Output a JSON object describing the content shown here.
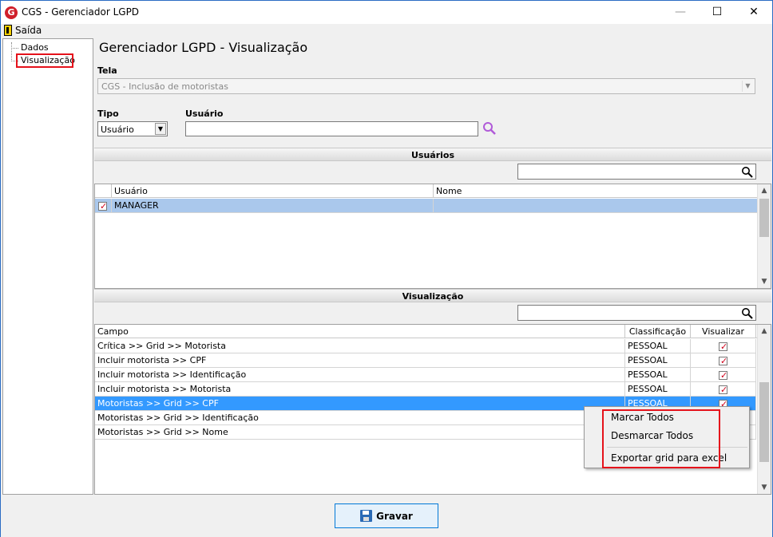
{
  "window": {
    "title": "CGS - Gerenciador LGPD",
    "app_icon_letter": "G"
  },
  "menu": {
    "exit_label": "Saída"
  },
  "tree": {
    "items": [
      "Dados",
      "Visualização"
    ]
  },
  "page": {
    "title": "Gerenciador LGPD - Visualização",
    "tela_label": "Tela",
    "tela_value": "CGS - Inclusão de motoristas",
    "tipo_label": "Tipo",
    "tipo_value": "Usuário",
    "usuario_label": "Usuário",
    "usuario_value": ""
  },
  "users_section": {
    "title": "Usuários",
    "columns": [
      "Usuário",
      "Nome"
    ],
    "rows": [
      {
        "checked": true,
        "usuario": "MANAGER",
        "nome": ""
      }
    ]
  },
  "view_section": {
    "title": "Visualização",
    "columns": [
      "Campo",
      "Classificação",
      "Visualizar"
    ],
    "rows": [
      {
        "campo": "Crítica >> Grid >> Motorista",
        "classificacao": "PESSOAL",
        "visualizar": true
      },
      {
        "campo": "Incluir motorista >> CPF",
        "classificacao": "PESSOAL",
        "visualizar": true
      },
      {
        "campo": "Incluir motorista >> Identificação",
        "classificacao": "PESSOAL",
        "visualizar": true
      },
      {
        "campo": "Incluir motorista >> Motorista",
        "classificacao": "PESSOAL",
        "visualizar": true
      },
      {
        "campo": "Motoristas >> Grid >> CPF",
        "classificacao": "PESSOAL",
        "visualizar": true
      },
      {
        "campo": "Motoristas >> Grid >> Identificação",
        "classificacao": "",
        "visualizar": false
      },
      {
        "campo": "Motoristas >> Grid >> Nome",
        "classificacao": "",
        "visualizar": false
      }
    ]
  },
  "context_menu": {
    "items": [
      "Marcar Todos",
      "Desmarcar Todos",
      "Exportar grid para excel"
    ]
  },
  "footer": {
    "save_label": "Gravar"
  },
  "colors": {
    "accent": "#0078d7",
    "selection": "#3399ff",
    "highlight_box": "#e5121b"
  }
}
